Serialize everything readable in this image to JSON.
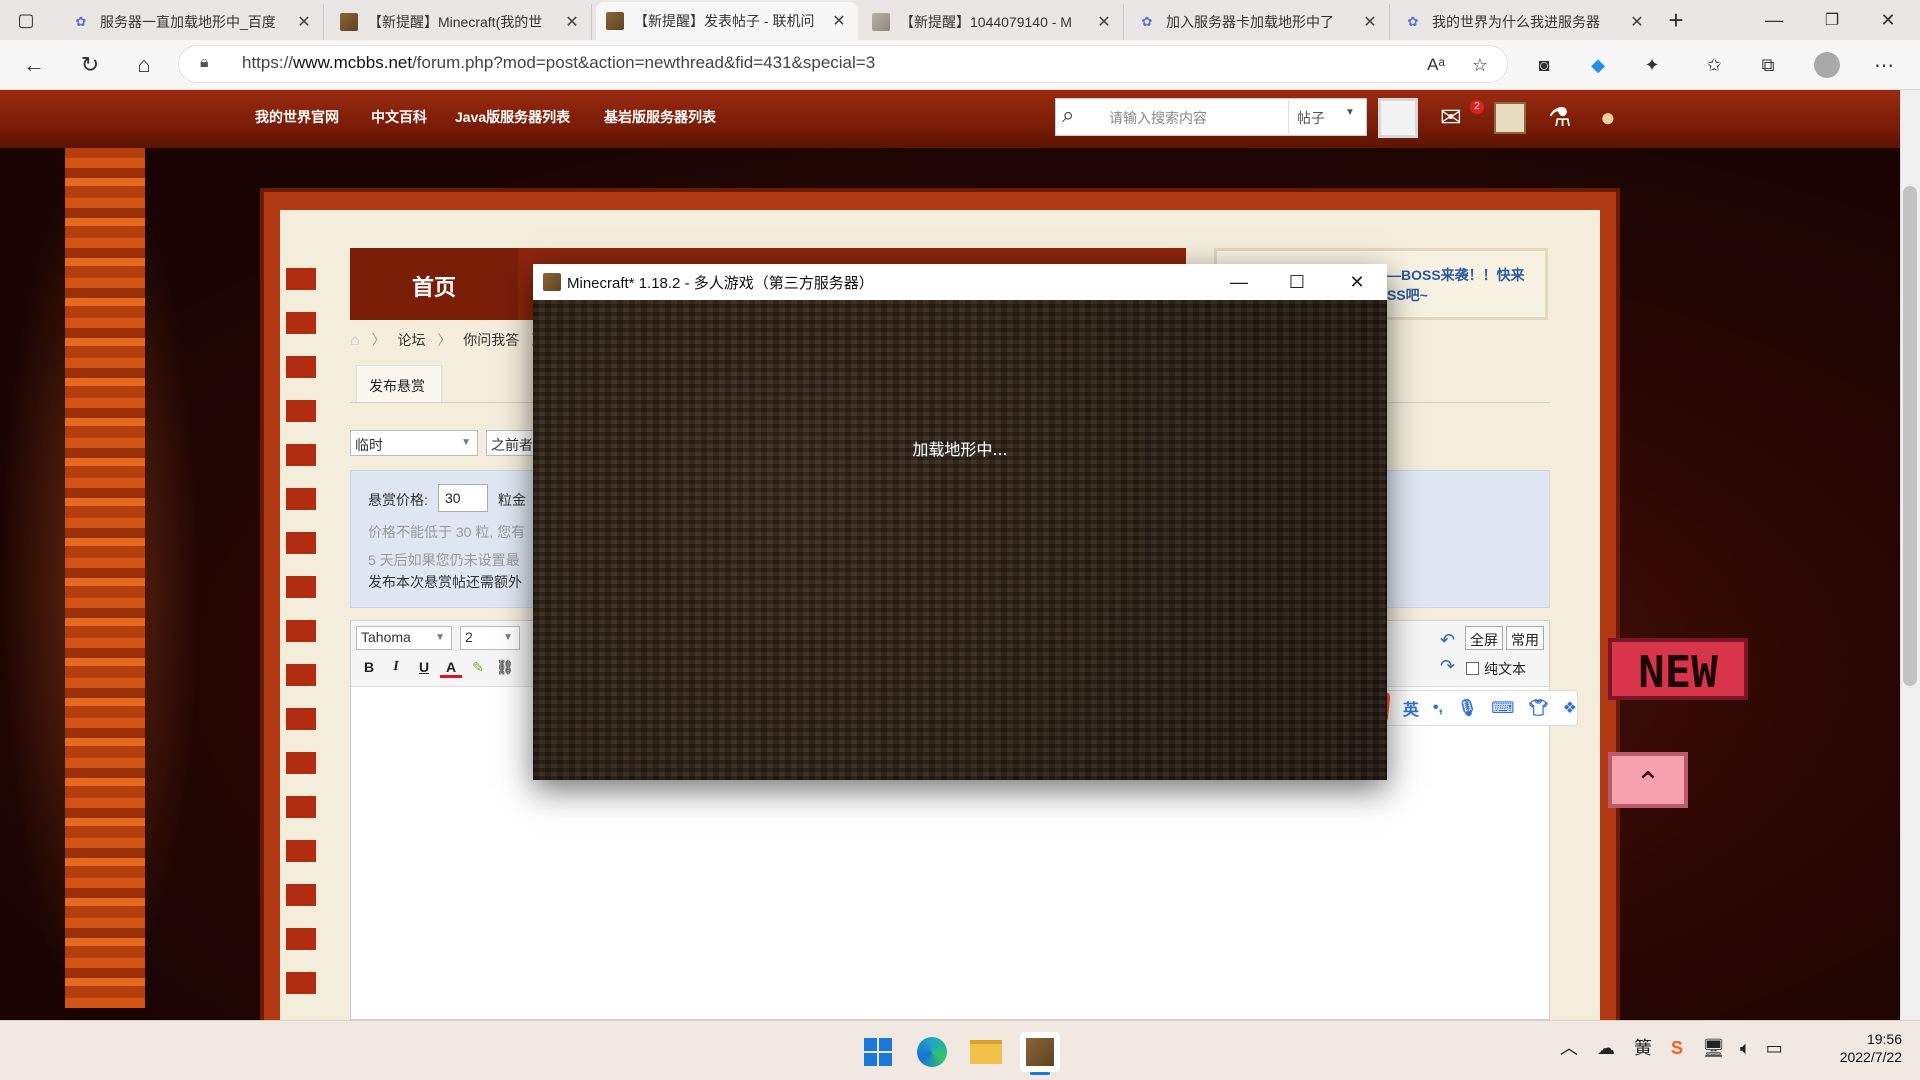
{
  "browser": {
    "tabs": [
      {
        "title": "服务器一直加载地形中_百度",
        "icon": "baidu-paw-icon",
        "active": false
      },
      {
        "title": "【新提醒】Minecraft(我的世",
        "icon": "minecraft-block-icon",
        "active": false
      },
      {
        "title": "【新提醒】发表帖子 - 联机问",
        "icon": "minecraft-block-icon",
        "active": true
      },
      {
        "title": "【新提醒】1044079140 - M",
        "icon": "mcbbs-block-icon",
        "active": false
      },
      {
        "title": "加入服务器卡加载地形中了",
        "icon": "baidu-paw-icon",
        "active": false
      },
      {
        "title": "我的世界为什么我进服务器",
        "icon": "baidu-paw-icon",
        "active": false
      }
    ],
    "url_prefix": "https://",
    "url_domain": "www.mcbbs.net",
    "url_path": "/forum.php?mod=post&action=newthread&fid=431&special=3"
  },
  "site": {
    "nav": [
      "我的世界官网",
      "中文百科",
      "Java版服务器列表",
      "基岩版服务器列表"
    ],
    "search_placeholder": "请输入搜索内容",
    "search_scope": "帖子"
  },
  "forum": {
    "home_tab": "首页",
    "side_notice": "—BOSS来袭！！快来\nSS吧~",
    "breadcrumb": [
      "论坛",
      "你问我答"
    ],
    "post_tab": "发布悬赏",
    "category_select": "临时",
    "prefix_select": "之前者",
    "reward_label": "悬赏价格:",
    "reward_value": "30",
    "reward_unit": "粒金",
    "reward_note1": "价格不能低于 30 粒, 您有",
    "reward_note2": "5 天后如果您仍未设置最",
    "reward_note3": "发布本次悬赏帖还需额外",
    "editor": {
      "font": "Tahoma",
      "size": "2",
      "fullscreen": "全屏",
      "common": "常用",
      "plaintext": "纯文本"
    }
  },
  "ime": {
    "mode": "英",
    "punct": "•,"
  },
  "badge": {
    "new": "NEW"
  },
  "game_window": {
    "title": "Minecraft* 1.18.2 - 多人游戏（第三方服务器）",
    "status": "加载地形中..."
  },
  "taskbar": {
    "time": "19:56",
    "date": "2022/7/22",
    "tray_ime": "簧"
  }
}
